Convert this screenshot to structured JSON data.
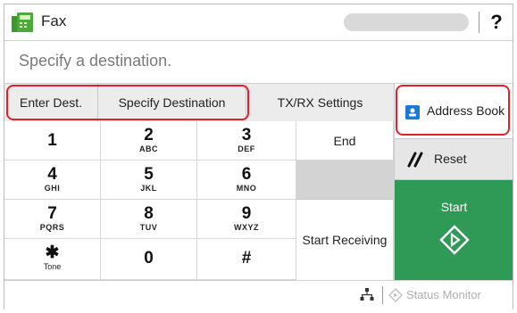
{
  "title_bar": {
    "title": "Fax",
    "help_label": "?"
  },
  "destination": {
    "placeholder": "Specify a destination."
  },
  "tabs": [
    {
      "label": "Enter Dest."
    },
    {
      "label": "Specify Destination"
    },
    {
      "label": "TX/RX Settings"
    }
  ],
  "keypad": [
    {
      "digit": "1",
      "letters": ""
    },
    {
      "digit": "2",
      "letters": "ABC"
    },
    {
      "digit": "3",
      "letters": "DEF"
    },
    {
      "digit": "4",
      "letters": "GHI"
    },
    {
      "digit": "5",
      "letters": "JKL"
    },
    {
      "digit": "6",
      "letters": "MNO"
    },
    {
      "digit": "7",
      "letters": "PQRS"
    },
    {
      "digit": "8",
      "letters": "TUV"
    },
    {
      "digit": "9",
      "letters": "WXYZ"
    },
    {
      "digit": "✱",
      "letters": "Tone"
    },
    {
      "digit": "0",
      "letters": ""
    },
    {
      "digit": "#",
      "letters": ""
    }
  ],
  "buttons": {
    "end": "End",
    "start_receiving": "Start Receiving",
    "address_book": "Address Book",
    "reset": "Reset",
    "start": "Start"
  },
  "status_bar": {
    "status_monitor": "Status Monitor"
  },
  "colors": {
    "start_green": "#2e9a55",
    "highlight_red": "#e0202b",
    "address_blue": "#1a7ad4"
  },
  "icons": {
    "app": "fax-machine-icon",
    "reset": "double-slash-reset-icon",
    "start": "diamond-start-icon",
    "network": "network-icon",
    "status": "status-monitor-icon",
    "address_book": "address-book-icon"
  }
}
